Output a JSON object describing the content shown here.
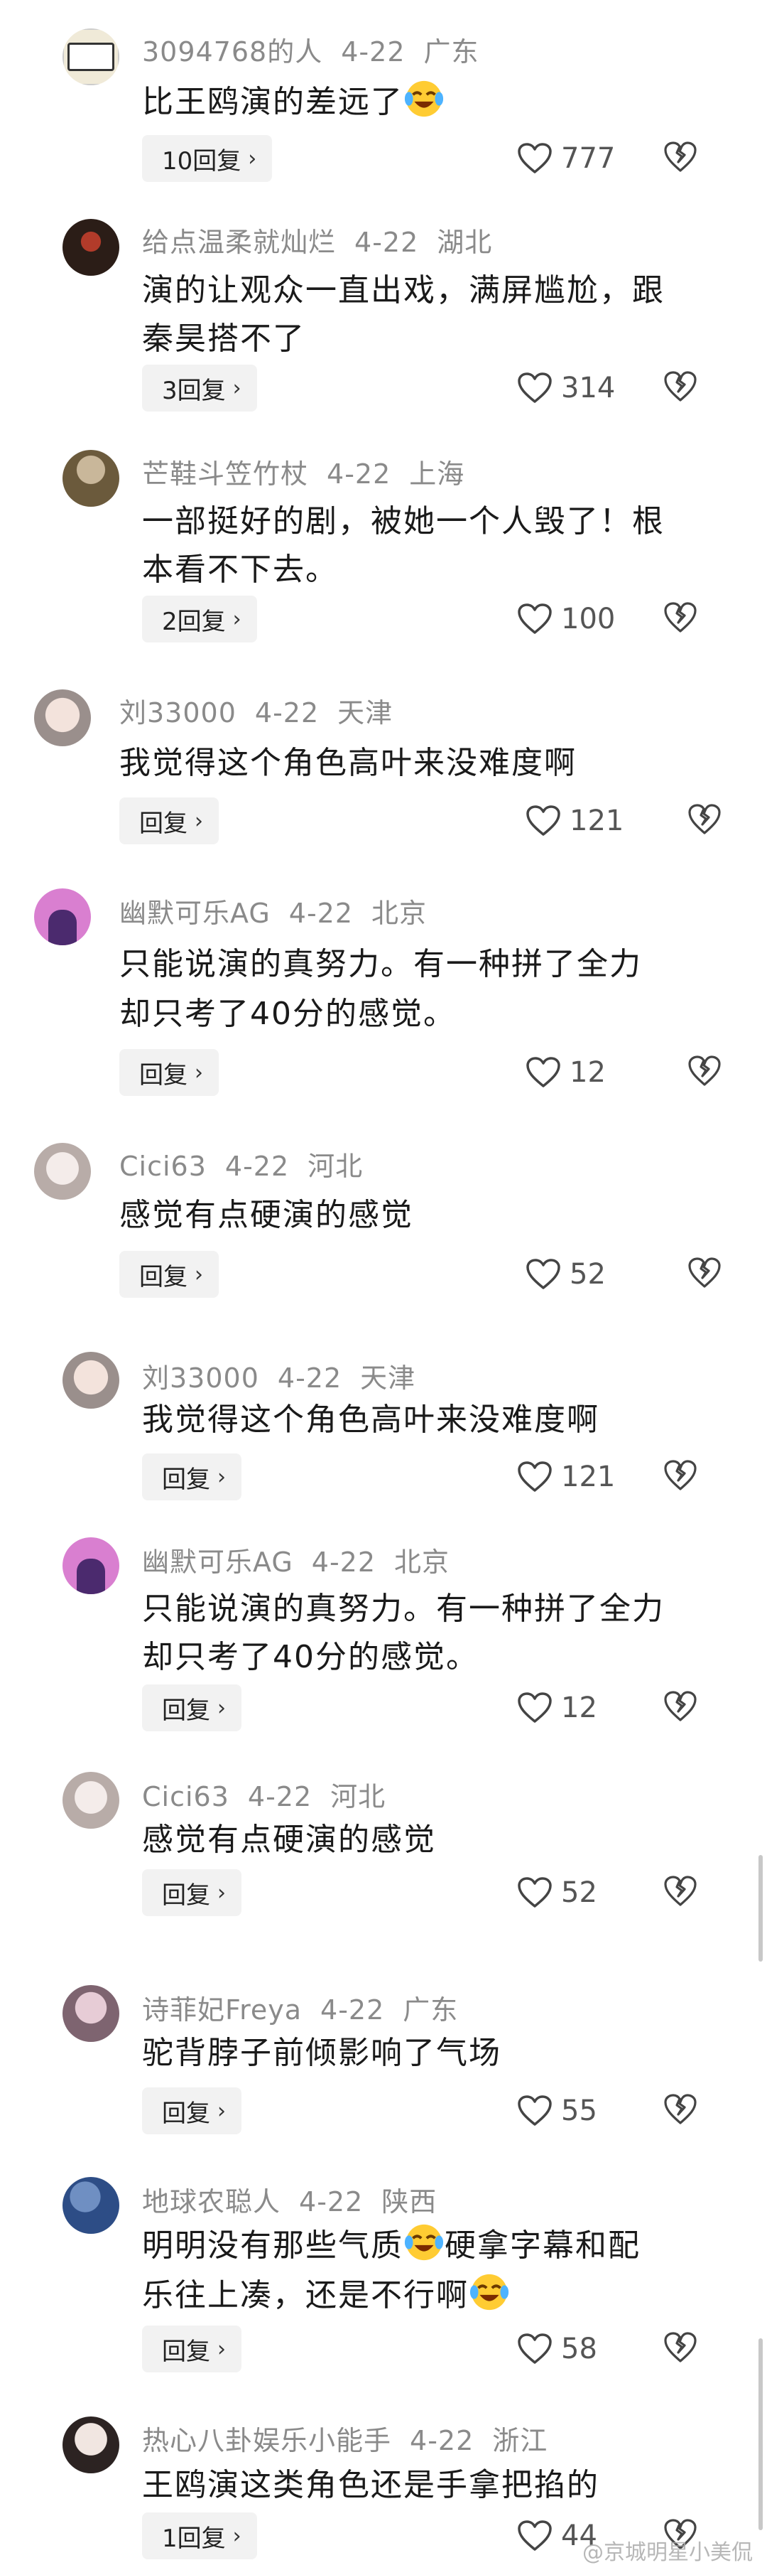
{
  "comments": [
    {
      "user": "3094768的人",
      "date": "4-22",
      "region": "广东",
      "lines": [
        "比王鸥演的差远了"
      ],
      "emoji_end": true,
      "reply": "10回复",
      "likes": "777"
    },
    {
      "user": "给点温柔就灿烂",
      "date": "4-22",
      "region": "湖北",
      "lines": [
        "演的让观众一直出戏，满屏尴尬，跟",
        "秦昊搭不了"
      ],
      "reply": "3回复",
      "likes": "314"
    },
    {
      "user": "芒鞋斗笠竹杖",
      "date": "4-22",
      "region": "上海",
      "lines": [
        "一部挺好的剧，被她一个人毁了！根",
        "本看不下去。"
      ],
      "reply": "2回复",
      "likes": "100"
    },
    {
      "user": "刘33000",
      "date": "4-22",
      "region": "天津",
      "lines": [
        "我觉得这个角色高叶来没难度啊"
      ],
      "reply": "回复",
      "likes": "121"
    },
    {
      "user": "幽默可乐AG",
      "date": "4-22",
      "region": "北京",
      "lines": [
        "只能说演的真努力。有一种拼了全力",
        "却只考了40分的感觉。"
      ],
      "reply": "回复",
      "likes": "12"
    },
    {
      "user": "Cici63",
      "date": "4-22",
      "region": "河北",
      "lines": [
        "感觉有点硬演的感觉"
      ],
      "reply": "回复",
      "likes": "52"
    },
    {
      "user": "刘33000",
      "date": "4-22",
      "region": "天津",
      "lines": [
        "我觉得这个角色高叶来没难度啊"
      ],
      "reply": "回复",
      "likes": "121"
    },
    {
      "user": "幽默可乐AG",
      "date": "4-22",
      "region": "北京",
      "lines": [
        "只能说演的真努力。有一种拼了全力",
        "却只考了40分的感觉。"
      ],
      "reply": "回复",
      "likes": "12"
    },
    {
      "user": "Cici63",
      "date": "4-22",
      "region": "河北",
      "lines": [
        "感觉有点硬演的感觉"
      ],
      "reply": "回复",
      "likes": "52"
    },
    {
      "user": "诗菲妃Freya",
      "date": "4-22",
      "region": "广东",
      "lines": [
        "驼背脖子前倾影响了气场"
      ],
      "reply": "回复",
      "likes": "55"
    },
    {
      "user": "地球农聪人",
      "date": "4-22",
      "region": "陕西",
      "lines_rich": [
        [
          "明明没有那些气质",
          "EMOJI",
          "硬拿字幕和配"
        ],
        [
          "乐往上凑，还是不行啊",
          "EMOJI"
        ]
      ],
      "reply": "回复",
      "likes": "58"
    },
    {
      "user": "热心八卦娱乐小能手",
      "date": "4-22",
      "region": "浙江",
      "lines": [
        "王鸥演这类角色还是手拿把掐的"
      ],
      "reply": "1回复",
      "likes": "44"
    }
  ],
  "watermark": "@京城明星小美侃",
  "icons": {
    "like": "heart-outline-icon",
    "dislike": "broken-heart-icon",
    "chevron": "chevron-right-icon"
  }
}
